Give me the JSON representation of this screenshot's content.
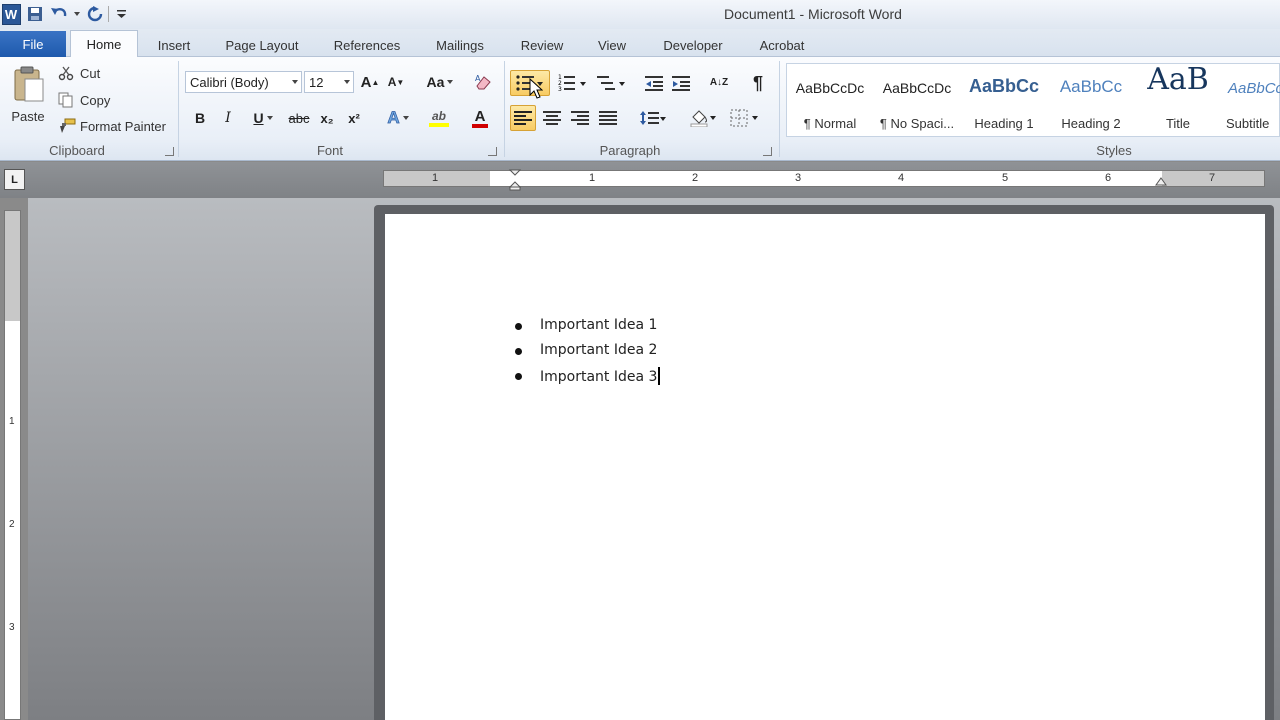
{
  "window": {
    "title": "Document1  -  Microsoft Word"
  },
  "qat": {
    "logo": "W"
  },
  "tabs": [
    "File",
    "Home",
    "Insert",
    "Page Layout",
    "References",
    "Mailings",
    "Review",
    "View",
    "Developer",
    "Acrobat"
  ],
  "clipboard": {
    "paste": "Paste",
    "cut": "Cut",
    "copy": "Copy",
    "format_painter": "Format Painter",
    "label": "Clipboard"
  },
  "font": {
    "name": "Calibri (Body)",
    "size": "12",
    "grow": "A",
    "shrink": "A",
    "case": "Aa",
    "bold": "B",
    "italic": "I",
    "underline": "U",
    "strike": "abc",
    "sub": "x₂",
    "sup": "x²",
    "effects": "A",
    "highlight": "ab",
    "color": "A",
    "label": "Font"
  },
  "paragraph": {
    "pilcrow": "¶",
    "sort": "A↓Z",
    "label": "Paragraph"
  },
  "styles": {
    "label": "Styles",
    "items": [
      {
        "preview": "AaBbCcDc",
        "name": "¶ Normal"
      },
      {
        "preview": "AaBbCcDc",
        "name": "¶ No Spaci..."
      },
      {
        "preview": "AaBbCc",
        "name": "Heading 1"
      },
      {
        "preview": "AaBbCc",
        "name": "Heading 2"
      },
      {
        "preview": "AaB",
        "name": "Title"
      },
      {
        "preview": "AaBbCc",
        "name": "Subtitle"
      }
    ]
  },
  "ruler": {
    "tab_selector": "L",
    "h_numbers": [
      "1",
      "1",
      "2",
      "3",
      "4",
      "5",
      "6",
      "7"
    ],
    "v_numbers": [
      "1",
      "2",
      "3"
    ]
  },
  "document": {
    "bullets": [
      "Important Idea 1",
      "Important Idea 2",
      "Important Idea 3"
    ]
  },
  "colors": {
    "file_tab": "#2a63b6",
    "active_button": "#f8cb63",
    "font_color": "#d00000",
    "highlight": "#ffff00"
  }
}
